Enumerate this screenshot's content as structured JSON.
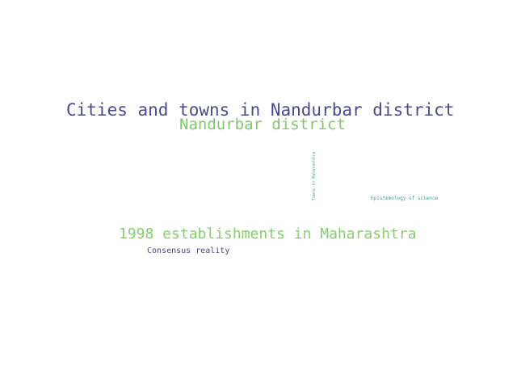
{
  "word_cloud": {
    "words": [
      {
        "text": "Cities and towns in Nandurbar district",
        "color": "#4b4a8f"
      },
      {
        "text": "Nandurbar district",
        "color": "#7ec86a"
      },
      {
        "text": "Towns in Maharashtra",
        "color": "#3fae8f"
      },
      {
        "text": "Epistemology of science",
        "color": "#2ea896"
      },
      {
        "text": "1998 establishments in Maharashtra",
        "color": "#86cd6d"
      },
      {
        "text": "Consensus reality",
        "color": "#4b3f8a"
      }
    ]
  }
}
